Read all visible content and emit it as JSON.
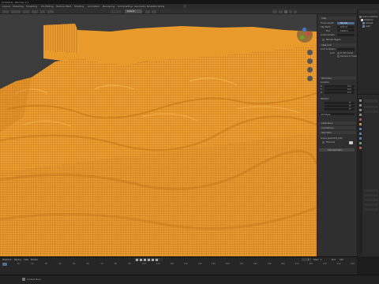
{
  "app": {
    "title": "[Untitled] - Blender 4.1"
  },
  "workspace_tabs": [
    "Layout",
    "Modeling",
    "Sculpting",
    "UV Editing",
    "Texture Paint",
    "Shading",
    "Animation",
    "Rendering",
    "Compositing",
    "Geometry Nodes",
    "Scripting"
  ],
  "viewport": {
    "shading_label": "Default",
    "colors": {
      "terrain": "#f0a030",
      "terrain_dark": "#c97c1c",
      "background": "#3c3c3c"
    },
    "gizmo_axes": [
      "X",
      "Y",
      "Z"
    ]
  },
  "npanel": {
    "tabs": [
      "Item",
      "Tool",
      "View"
    ],
    "view_section": "View",
    "focal_label": "Focal Length",
    "focal_value": "50 mm",
    "clip_start_label": "Clip Start",
    "clip_start_value": "0.01 m",
    "clip_end_label": "End",
    "clip_end_value": "1000 m",
    "local_camera_label": "Local Camera",
    "render_region_label": "Render Region",
    "view_lock_section": "View Lock",
    "lock_to_object_label": "Lock to Object",
    "lock_label": "Lock",
    "lock_cursor_label": "To 3D Cursor",
    "lock_camera_label": "Camera to View",
    "cursor_section": "3D Cursor",
    "location_label": "Location",
    "x_label": "X",
    "x_value": "0 m",
    "y_label": "Y",
    "y_value": "0 m",
    "z_label": "Z",
    "z_value": "0 m",
    "rotation_label": "Rotation",
    "rx_value": "0°",
    "ry_value": "0°",
    "rz_value": "0°",
    "xyz_euler": "XYZ Euler",
    "collections_section": "Collections",
    "annotations_section": "Annotations",
    "geometry_section": "Geometry",
    "scene_geometry_label": "Scene geometry (Alt)",
    "flat_label": "Flat mat",
    "add_label": "Add Geometry"
  },
  "outliner": {
    "items": [
      "Scene Collection",
      "Collection",
      "Camera",
      "Light"
    ]
  },
  "timeline": {
    "labels": [
      "Playback",
      "Keying",
      "View",
      "Marker"
    ],
    "ticks": [
      "0",
      "10",
      "20",
      "30",
      "40",
      "50",
      "60",
      "70",
      "80",
      "90",
      "100",
      "110",
      "120",
      "130",
      "140",
      "150",
      "160",
      "170",
      "180",
      "190",
      "200",
      "210",
      "220",
      "230",
      "240",
      "250"
    ],
    "current_frame": "1",
    "start_label": "Start",
    "start_value": "1",
    "end_label": "End",
    "end_value": "250"
  },
  "statusbar": {
    "text": "Context Menu"
  }
}
